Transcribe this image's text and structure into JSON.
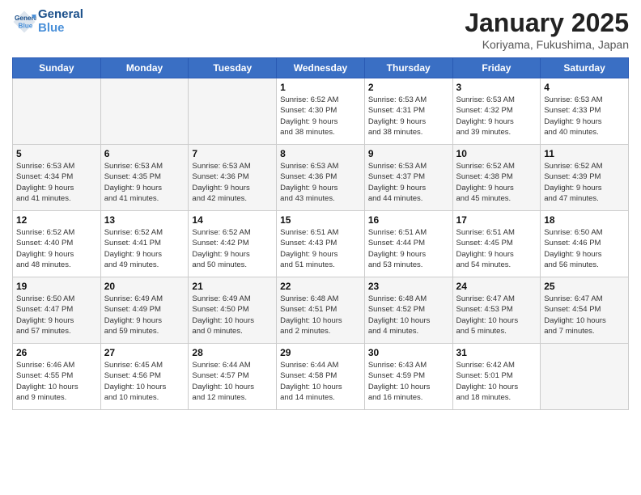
{
  "header": {
    "logo_line1": "General",
    "logo_line2": "Blue",
    "month_title": "January 2025",
    "subtitle": "Koriyama, Fukushima, Japan"
  },
  "weekdays": [
    "Sunday",
    "Monday",
    "Tuesday",
    "Wednesday",
    "Thursday",
    "Friday",
    "Saturday"
  ],
  "weeks": [
    [
      {
        "day": "",
        "info": ""
      },
      {
        "day": "",
        "info": ""
      },
      {
        "day": "",
        "info": ""
      },
      {
        "day": "1",
        "info": "Sunrise: 6:52 AM\nSunset: 4:30 PM\nDaylight: 9 hours\nand 38 minutes."
      },
      {
        "day": "2",
        "info": "Sunrise: 6:53 AM\nSunset: 4:31 PM\nDaylight: 9 hours\nand 38 minutes."
      },
      {
        "day": "3",
        "info": "Sunrise: 6:53 AM\nSunset: 4:32 PM\nDaylight: 9 hours\nand 39 minutes."
      },
      {
        "day": "4",
        "info": "Sunrise: 6:53 AM\nSunset: 4:33 PM\nDaylight: 9 hours\nand 40 minutes."
      }
    ],
    [
      {
        "day": "5",
        "info": "Sunrise: 6:53 AM\nSunset: 4:34 PM\nDaylight: 9 hours\nand 41 minutes."
      },
      {
        "day": "6",
        "info": "Sunrise: 6:53 AM\nSunset: 4:35 PM\nDaylight: 9 hours\nand 41 minutes."
      },
      {
        "day": "7",
        "info": "Sunrise: 6:53 AM\nSunset: 4:36 PM\nDaylight: 9 hours\nand 42 minutes."
      },
      {
        "day": "8",
        "info": "Sunrise: 6:53 AM\nSunset: 4:36 PM\nDaylight: 9 hours\nand 43 minutes."
      },
      {
        "day": "9",
        "info": "Sunrise: 6:53 AM\nSunset: 4:37 PM\nDaylight: 9 hours\nand 44 minutes."
      },
      {
        "day": "10",
        "info": "Sunrise: 6:52 AM\nSunset: 4:38 PM\nDaylight: 9 hours\nand 45 minutes."
      },
      {
        "day": "11",
        "info": "Sunrise: 6:52 AM\nSunset: 4:39 PM\nDaylight: 9 hours\nand 47 minutes."
      }
    ],
    [
      {
        "day": "12",
        "info": "Sunrise: 6:52 AM\nSunset: 4:40 PM\nDaylight: 9 hours\nand 48 minutes."
      },
      {
        "day": "13",
        "info": "Sunrise: 6:52 AM\nSunset: 4:41 PM\nDaylight: 9 hours\nand 49 minutes."
      },
      {
        "day": "14",
        "info": "Sunrise: 6:52 AM\nSunset: 4:42 PM\nDaylight: 9 hours\nand 50 minutes."
      },
      {
        "day": "15",
        "info": "Sunrise: 6:51 AM\nSunset: 4:43 PM\nDaylight: 9 hours\nand 51 minutes."
      },
      {
        "day": "16",
        "info": "Sunrise: 6:51 AM\nSunset: 4:44 PM\nDaylight: 9 hours\nand 53 minutes."
      },
      {
        "day": "17",
        "info": "Sunrise: 6:51 AM\nSunset: 4:45 PM\nDaylight: 9 hours\nand 54 minutes."
      },
      {
        "day": "18",
        "info": "Sunrise: 6:50 AM\nSunset: 4:46 PM\nDaylight: 9 hours\nand 56 minutes."
      }
    ],
    [
      {
        "day": "19",
        "info": "Sunrise: 6:50 AM\nSunset: 4:47 PM\nDaylight: 9 hours\nand 57 minutes."
      },
      {
        "day": "20",
        "info": "Sunrise: 6:49 AM\nSunset: 4:49 PM\nDaylight: 9 hours\nand 59 minutes."
      },
      {
        "day": "21",
        "info": "Sunrise: 6:49 AM\nSunset: 4:50 PM\nDaylight: 10 hours\nand 0 minutes."
      },
      {
        "day": "22",
        "info": "Sunrise: 6:48 AM\nSunset: 4:51 PM\nDaylight: 10 hours\nand 2 minutes."
      },
      {
        "day": "23",
        "info": "Sunrise: 6:48 AM\nSunset: 4:52 PM\nDaylight: 10 hours\nand 4 minutes."
      },
      {
        "day": "24",
        "info": "Sunrise: 6:47 AM\nSunset: 4:53 PM\nDaylight: 10 hours\nand 5 minutes."
      },
      {
        "day": "25",
        "info": "Sunrise: 6:47 AM\nSunset: 4:54 PM\nDaylight: 10 hours\nand 7 minutes."
      }
    ],
    [
      {
        "day": "26",
        "info": "Sunrise: 6:46 AM\nSunset: 4:55 PM\nDaylight: 10 hours\nand 9 minutes."
      },
      {
        "day": "27",
        "info": "Sunrise: 6:45 AM\nSunset: 4:56 PM\nDaylight: 10 hours\nand 10 minutes."
      },
      {
        "day": "28",
        "info": "Sunrise: 6:44 AM\nSunset: 4:57 PM\nDaylight: 10 hours\nand 12 minutes."
      },
      {
        "day": "29",
        "info": "Sunrise: 6:44 AM\nSunset: 4:58 PM\nDaylight: 10 hours\nand 14 minutes."
      },
      {
        "day": "30",
        "info": "Sunrise: 6:43 AM\nSunset: 4:59 PM\nDaylight: 10 hours\nand 16 minutes."
      },
      {
        "day": "31",
        "info": "Sunrise: 6:42 AM\nSunset: 5:01 PM\nDaylight: 10 hours\nand 18 minutes."
      },
      {
        "day": "",
        "info": ""
      }
    ]
  ]
}
